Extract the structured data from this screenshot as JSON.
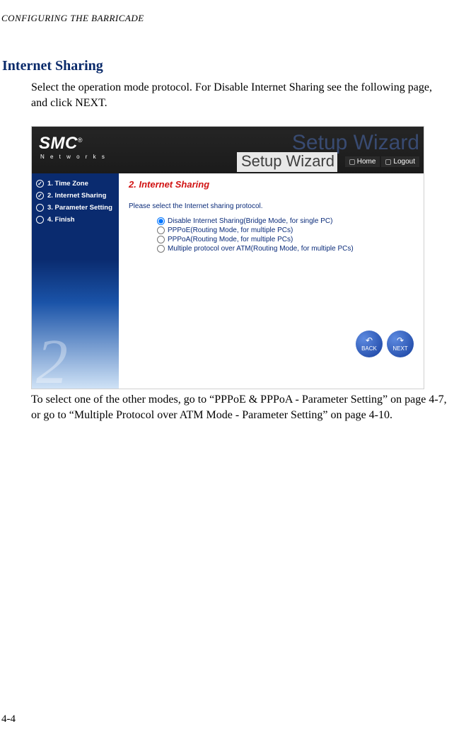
{
  "running_head": "CONFIGURING THE BARRICADE",
  "section_title": "Internet Sharing",
  "intro_text": "Select the operation mode protocol. For Disable Internet Sharing see the following page, and click NEXT.",
  "outro_text": "To select one of the other modes, go to “PPPoE & PPPoA - Parameter Setting” on page 4-7, or go to “Multiple Protocol over ATM Mode - Parameter Setting” on page 4-10.",
  "page_number": "4-4",
  "screenshot": {
    "logo_main": "SMC",
    "logo_reg": "®",
    "logo_sub": "N e t w o r k s",
    "watermark": "Setup Wizard",
    "title": "Setup Wizard",
    "home_label": "Home",
    "logout_label": "Logout",
    "sidebar": {
      "items": [
        {
          "label": "1. Time Zone",
          "done": true
        },
        {
          "label": "2. Internet Sharing",
          "done": true
        },
        {
          "label": "3. Parameter Setting",
          "done": false
        },
        {
          "label": "4. Finish",
          "done": false
        }
      ],
      "bg_num": "2"
    },
    "main": {
      "step_title": "2. Internet Sharing",
      "instruction": "Please select the Internet sharing protocol.",
      "options": [
        "Disable Internet Sharing(Bridge Mode, for single PC)",
        "PPPoE(Routing Mode, for multiple PCs)",
        "PPPoA(Routing Mode, for multiple PCs)",
        "Multiple protocol over ATM(Routing Mode, for multiple PCs)"
      ],
      "back_label": "BACK",
      "next_label": "NEXT"
    }
  }
}
